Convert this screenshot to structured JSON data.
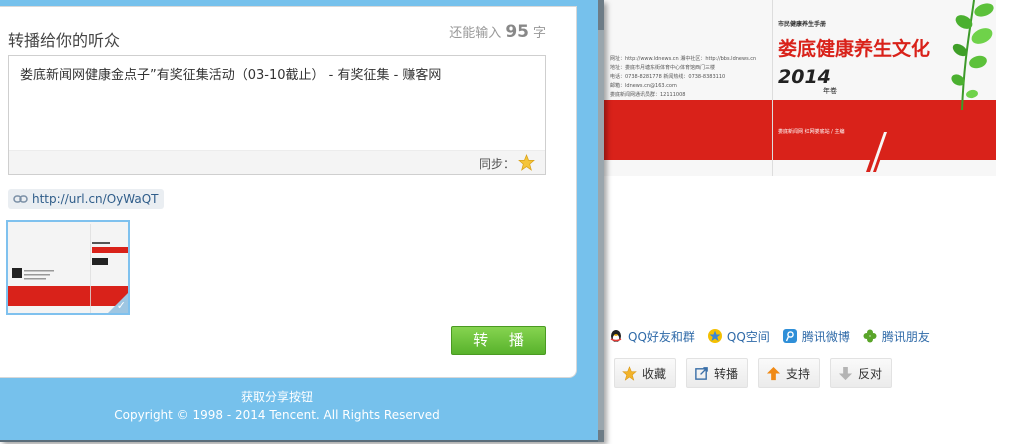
{
  "dialog": {
    "title": "转播给你的听众",
    "counter_prefix": "还能输入",
    "counter_value": "95",
    "counter_suffix": "字",
    "message": "娄底新闻网健康金点子”有奖征集活动（03-10截止） - 有奖征集 - 赚客网",
    "sync_label": "同步：",
    "short_link": "http://url.cn/OyWaQT",
    "share_button": "转 播",
    "footer_get_button": "获取分享按钮",
    "footer_copyright": "Copyright © 1998 - 2014 Tencent. All Rights Reserved"
  },
  "cover": {
    "subtitle": "市民健康养生手册",
    "title": "娄底健康养生文化",
    "year": "2014",
    "year_tag": "年卷",
    "info_lines": [
      "网址：http://www.ldnews.cn 湘中社区：http://bbs.ldnews.cn",
      "地址：娄底市月塘东街体育中心体育馆西门三楼",
      "电话：0738-8281778 新闻热线：0738-8383110",
      "邮箱：ldnews.cn@163.com",
      "娄底新闻网通讯员群：12111008"
    ],
    "credit": "娄底新闻网 红网娄底站 / 主编"
  },
  "share_links": [
    {
      "label": "QQ好友和群",
      "icon": "qq-penguin-icon"
    },
    {
      "label": "QQ空间",
      "icon": "qzone-star-icon"
    },
    {
      "label": "腾讯微博",
      "icon": "tencent-weibo-icon"
    },
    {
      "label": "腾讯朋友",
      "icon": "clover-icon"
    }
  ],
  "actions": [
    {
      "label": "收藏",
      "icon": "star-icon"
    },
    {
      "label": "转播",
      "icon": "repost-icon"
    },
    {
      "label": "支持",
      "icon": "up-arrow-icon"
    },
    {
      "label": "反对",
      "icon": "down-arrow-icon"
    }
  ],
  "colors": {
    "popup_blue": "#76c1ec",
    "button_green": "#58b22c",
    "link_blue": "#2f6aa8",
    "cover_red": "#d9221a"
  }
}
